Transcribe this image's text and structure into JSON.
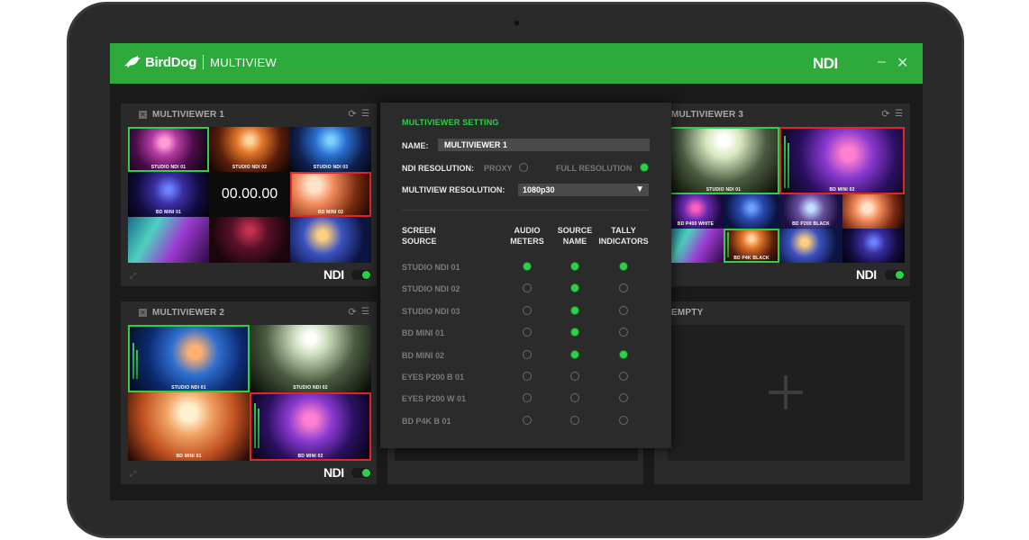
{
  "app": {
    "brand": "BirdDog",
    "title": "MULTIVIEW",
    "ndi_logo": "NDI",
    "minimize_icon": "–",
    "close_icon": "✕"
  },
  "panels": {
    "mv1": {
      "title": "MULTIVIEWER 1",
      "ndi": "NDI",
      "timer": "00.00.00",
      "cells": [
        "STUDIO NDI 01",
        "STUDIO NDI 02",
        "STUDIO NDI 03",
        "BD MINI 01",
        "BD MINI 02"
      ]
    },
    "mv2": {
      "title": "MULTIVIEWER 2",
      "ndi": "NDI",
      "cells": [
        "STUDIO NDI 01",
        "STUDIO NDI 02",
        "BD MINI 01",
        "BD MINI 02"
      ]
    },
    "mv3": {
      "title": "MULTIVIEWER 3",
      "ndi": "NDI",
      "cells": [
        "STUDIO NDI 01",
        "BD MINI 02",
        "BD P400 WHITE",
        "BD P200 BLACK",
        "BD P4K BLACK"
      ]
    },
    "empty": {
      "title": "EMPTY",
      "plus": "+"
    }
  },
  "settings": {
    "title": "MULTIVIEWER SETTING",
    "name_label": "NAME:",
    "name_value": "MULTIVIEWER 1",
    "ndi_res_label": "NDI RESOLUTION:",
    "proxy_label": "PROXY",
    "full_res_label": "FULL RESOLUTION",
    "proxy_selected": false,
    "full_res_selected": true,
    "mv_res_label": "MULTIVIEW RESOLUTION:",
    "mv_res_value": "1080p30",
    "col_screen_source": [
      "SCREEN",
      "SOURCE"
    ],
    "col_audio": [
      "AUDIO",
      "METERS"
    ],
    "col_source_name": [
      "SOURCE",
      "NAME"
    ],
    "col_tally": [
      "TALLY",
      "INDICATORS"
    ],
    "sources": [
      {
        "name": "STUDIO NDI 01",
        "audio": true,
        "source_name": true,
        "tally": true
      },
      {
        "name": "STUDIO NDI 02",
        "audio": false,
        "source_name": true,
        "tally": false
      },
      {
        "name": "STUDIO NDI 03",
        "audio": false,
        "source_name": true,
        "tally": false
      },
      {
        "name": "BD MINI 01",
        "audio": false,
        "source_name": true,
        "tally": false
      },
      {
        "name": "BD MINI 02",
        "audio": false,
        "source_name": true,
        "tally": true
      },
      {
        "name": "EYES P200 B 01",
        "audio": false,
        "source_name": false,
        "tally": false
      },
      {
        "name": "EYES P200 W 01",
        "audio": false,
        "source_name": false,
        "tally": false
      },
      {
        "name": "BD P4K B 01",
        "audio": false,
        "source_name": false,
        "tally": false
      }
    ]
  },
  "colors": {
    "brand_green": "#2eaa3c",
    "tally_green": "#2ed045",
    "tally_red": "#e0262b",
    "panel_bg": "#2a2a2a"
  }
}
